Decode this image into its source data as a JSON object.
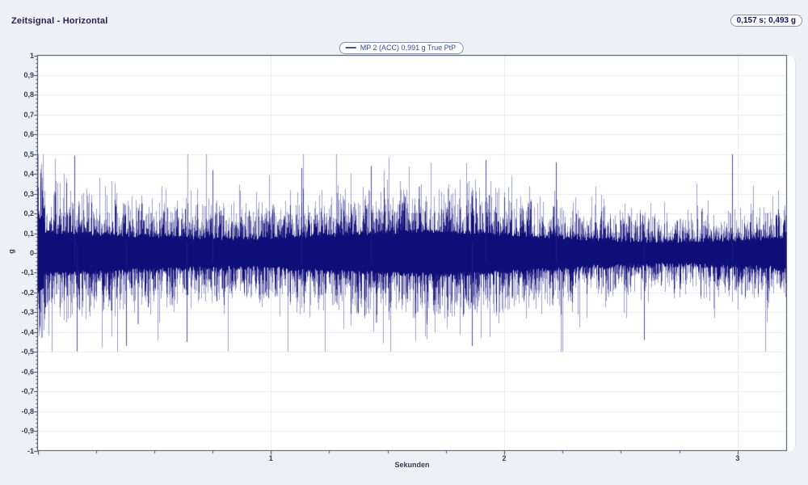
{
  "app": {
    "title": "Zeitsignal - Horizontal",
    "cursor_readout": "0,157 s; 0,493 g"
  },
  "colors": {
    "page_bg": "#edf0f5",
    "panel_bg": "#ffffff",
    "frame": "#3d4759",
    "grid_horizontal": "#ebebf2",
    "grid_vertical": "#e3e7ee",
    "waveform_core": "#0e0e78",
    "waveform_light": "rgba(24,24,130,0.42)",
    "waveform_mid": "rgba(17,17,122,0.8)",
    "peak_stroke": "rgba(32,32,138,0.8)",
    "title_text": "#2e1b4e",
    "tick_text": "#31405a",
    "legend_text": "#2c4fa3",
    "legend_border": "#7a90c8",
    "readout_text": "#14146a"
  },
  "chart_data": {
    "type": "line",
    "title": "Zeitsignal - Horizontal",
    "legend": {
      "position": "top-center",
      "series_label": "MP 2 (ACC) 0,991 g True PtP",
      "series_name": "MP 2 (ACC)",
      "true_ptp_g": 0.991
    },
    "cursor_readout": {
      "time_s": 0.157,
      "amplitude_g": 0.493,
      "text": "0,157 s; 0,493 g"
    },
    "xlabel": "Sekunden",
    "ylabel": "g",
    "xlim": [
      0,
      3.21
    ],
    "ylim": [
      -1,
      1
    ],
    "grid": true,
    "x_axis": {
      "major_ticks": [
        1,
        2,
        3
      ],
      "tick_labels": [
        "1",
        "2",
        "3"
      ],
      "minor_step": 0.25
    },
    "y_axis": {
      "major_step": 0.1,
      "minor_step": 0.02,
      "tick_values": [
        1,
        0.9,
        0.8,
        0.7,
        0.6,
        0.5,
        0.4,
        0.3,
        0.2,
        0.1,
        0,
        -0.1,
        -0.2,
        -0.3,
        -0.4,
        -0.5,
        -0.6,
        -0.7,
        -0.8,
        -0.9,
        -1
      ],
      "tick_labels": [
        "1",
        "0,9",
        "0,8",
        "0,7",
        "0,6",
        "0,5",
        "0,4",
        "0,3",
        "0,2",
        "0,1",
        "0",
        "-0,1",
        "-0,2",
        "-0,3",
        "-0,4",
        "-0,5",
        "-0,6",
        "-0,7",
        "-0,8",
        "-0,9",
        "-1"
      ]
    },
    "signal": {
      "kind": "broadband-random-vibration",
      "seed": 20157,
      "duration_s": 3.21,
      "core_sigma_g": 0.12,
      "typical_extreme_g": 0.3,
      "max_peak_g": 0.5,
      "min_peak_g": -0.5,
      "peak_to_peak_g": 0.991,
      "spike_probability": 0.22,
      "start_burst_gain": 1.8,
      "feature_peaks": [
        {
          "t": 0.157,
          "g": 0.493
        },
        {
          "t": 0.168,
          "g": -0.498
        },
        {
          "t": 0.38,
          "g": -0.47
        },
        {
          "t": 0.64,
          "g": -0.45
        },
        {
          "t": 0.75,
          "g": 0.42
        },
        {
          "t": 1.13,
          "g": 0.43
        },
        {
          "t": 1.43,
          "g": 0.44
        },
        {
          "t": 1.86,
          "g": -0.47
        },
        {
          "t": 1.92,
          "g": 0.47
        },
        {
          "t": 2.22,
          "g": 0.46
        },
        {
          "t": 2.6,
          "g": -0.44
        },
        {
          "t": 2.975,
          "g": 0.5
        }
      ]
    }
  }
}
